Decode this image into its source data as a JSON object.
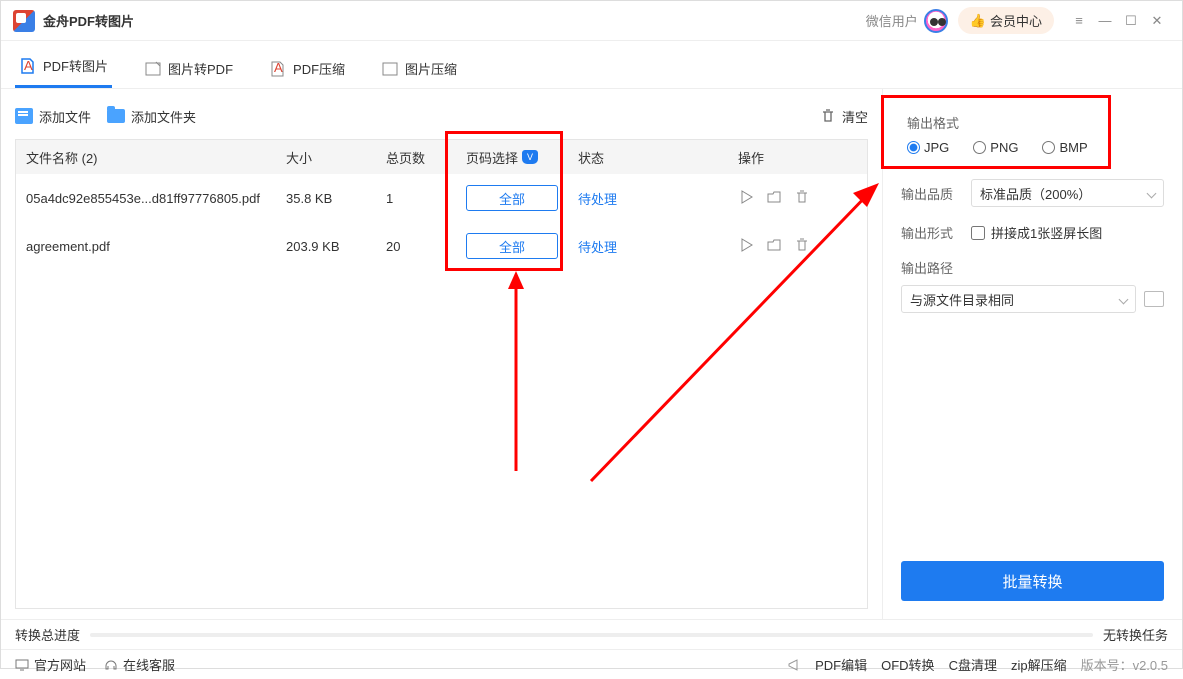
{
  "titlebar": {
    "app_name": "金舟PDF转图片",
    "wechat_label": "微信用户",
    "member_label": "会员中心"
  },
  "tabs": [
    {
      "label": "PDF转图片",
      "active": true
    },
    {
      "label": "图片转PDF",
      "active": false
    },
    {
      "label": "PDF压缩",
      "active": false
    },
    {
      "label": "图片压缩",
      "active": false
    }
  ],
  "toolbar": {
    "add_file": "添加文件",
    "add_folder": "添加文件夹",
    "clear": "清空"
  },
  "table": {
    "headers": {
      "name": "文件名称 (2)",
      "size": "大小",
      "pages": "总页数",
      "range": "页码选择",
      "status": "状态",
      "ops": "操作"
    },
    "range_btn": "全部",
    "rows": [
      {
        "name": "05a4dc92e855453e...d81ff97776805.pdf",
        "size": "35.8 KB",
        "pages": "1",
        "status": "待处理"
      },
      {
        "name": "agreement.pdf",
        "size": "203.9 KB",
        "pages": "20",
        "status": "待处理"
      }
    ]
  },
  "right": {
    "format_title": "输出格式",
    "formats": [
      "JPG",
      "PNG",
      "BMP"
    ],
    "quality_label": "输出品质",
    "quality_value": "标准品质（200%）",
    "form_label": "输出形式",
    "form_check": "拼接成1张竖屏长图",
    "path_label": "输出路径",
    "path_value": "与源文件目录相同",
    "convert": "批量转换"
  },
  "progress": {
    "label": "转换总进度",
    "none": "无转换任务"
  },
  "footer": {
    "left": [
      {
        "label": "官方网站"
      },
      {
        "label": "在线客服"
      }
    ],
    "right": [
      {
        "label": "PDF编辑"
      },
      {
        "label": "OFD转换"
      },
      {
        "label": "C盘清理"
      },
      {
        "label": "zip解压缩"
      }
    ],
    "version": "版本号：v2.0.5"
  }
}
